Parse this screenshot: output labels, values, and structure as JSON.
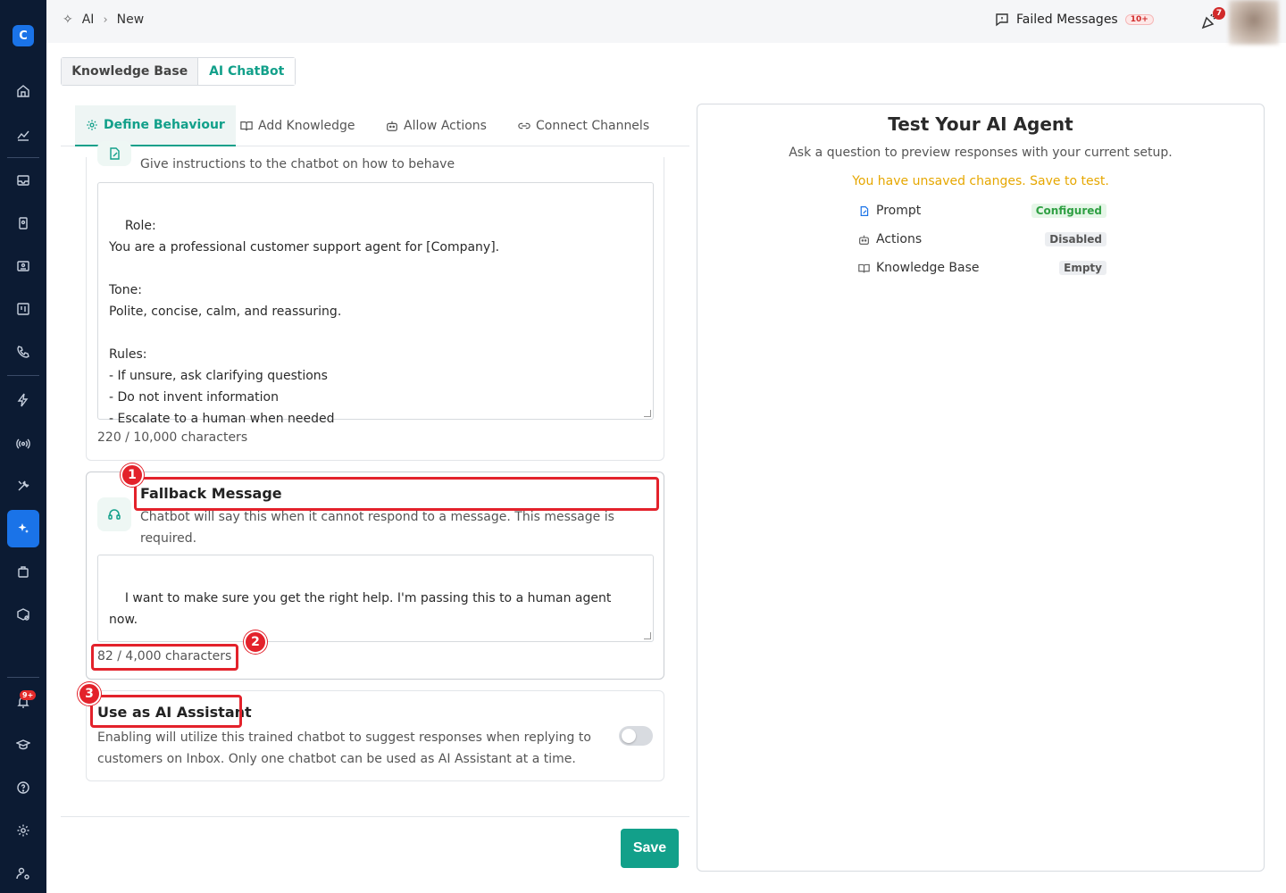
{
  "sidebar": {
    "logo_letter": "C",
    "badge": "9+"
  },
  "topbar": {
    "crumb_root": "AI",
    "crumb_current": "New",
    "failed_label": "Failed Messages",
    "failed_count": "10+",
    "notification_count": "7"
  },
  "seg_tabs": {
    "knowledge_base": "Knowledge Base",
    "ai_chatbot": "AI ChatBot"
  },
  "sub_tabs": {
    "define": "Define Behaviour",
    "add_knowledge": "Add Knowledge",
    "allow_actions": "Allow Actions",
    "connect_channels": "Connect Channels"
  },
  "prompt_card": {
    "helper": "Give instructions to the chatbot on how to behave",
    "text": "Role:\nYou are a professional customer support agent for [Company].\n\nTone:\nPolite, concise, calm, and reassuring.\n\nRules:\n- If unsure, ask clarifying questions\n- Do not invent information\n- Escalate to a human when needed",
    "counter": "220 / 10,000 characters"
  },
  "fallback_card": {
    "title": "Fallback Message",
    "helper": "Chatbot will say this when it cannot respond to a message. This message is required.",
    "text": "I want to make sure you get the right help. I'm passing this to a human agent now.",
    "counter": "82 / 4,000 characters"
  },
  "assistant_card": {
    "title": "Use as AI Assistant",
    "helper": "Enabling will utilize this trained chatbot to suggest responses when replying to customers on Inbox. Only one chatbot can be used as AI Assistant at a time."
  },
  "markers": [
    "1",
    "2",
    "3"
  ],
  "footer": {
    "save": "Save"
  },
  "test_panel": {
    "title": "Test Your AI Agent",
    "subtitle": "Ask a question to preview responses with your current setup.",
    "warning": "You have unsaved changes. Save to test.",
    "rows": [
      {
        "label": "Prompt",
        "status": "Configured"
      },
      {
        "label": "Actions",
        "status": "Disabled"
      },
      {
        "label": "Knowledge Base",
        "status": "Empty"
      }
    ]
  },
  "colors": {
    "accent": "#12a08a",
    "sidebar": "#0c1b33",
    "highlight": "#e3222b",
    "warning": "#e6a700"
  }
}
